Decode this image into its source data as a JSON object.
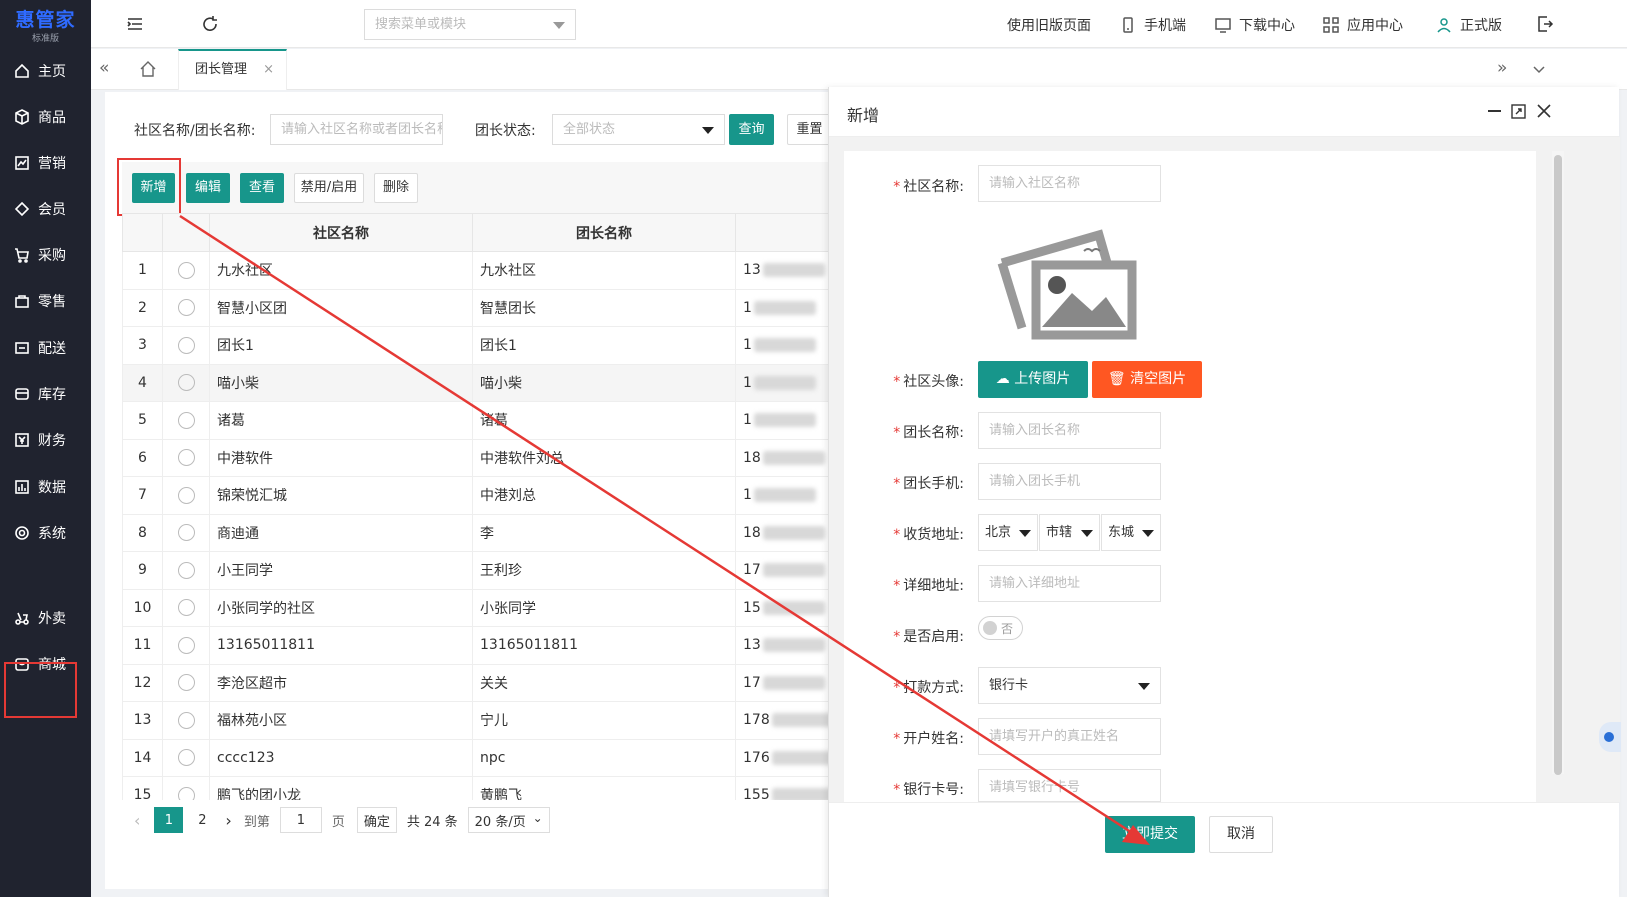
{
  "app": {
    "logo": "惠管家",
    "edition": "标准版"
  },
  "sidebar": {
    "items": [
      {
        "label": "主页",
        "icon": "home-icon"
      },
      {
        "label": "商品",
        "icon": "cube-icon"
      },
      {
        "label": "营销",
        "icon": "chart-icon"
      },
      {
        "label": "会员",
        "icon": "diamond-icon"
      },
      {
        "label": "采购",
        "icon": "cart-icon"
      },
      {
        "label": "零售",
        "icon": "bag-icon"
      },
      {
        "label": "配送",
        "icon": "truck-icon"
      },
      {
        "label": "库存",
        "icon": "box-icon"
      },
      {
        "label": "财务",
        "icon": "yen-icon"
      },
      {
        "label": "数据",
        "icon": "bar-chart-icon"
      },
      {
        "label": "系统",
        "icon": "settings-icon"
      },
      {
        "label": "外卖",
        "icon": "takeout-icon"
      },
      {
        "label": "商城",
        "icon": "mall-icon"
      }
    ]
  },
  "header": {
    "search_placeholder": "搜索菜单或模块",
    "links": [
      "使用旧版页面",
      "手机端",
      "下载中心",
      "应用中心",
      "正式版"
    ]
  },
  "tabs": {
    "active": "团长管理",
    "close": "×"
  },
  "filter": {
    "name_label": "社区名称/团长名称:",
    "name_placeholder": "请输入社区名称或者团长名称",
    "status_label": "团长状态:",
    "status_value": "全部状态",
    "query": "查询",
    "reset": "重置"
  },
  "toolbar": {
    "add": "新增",
    "edit": "编辑",
    "view": "查看",
    "toggle": "禁用/启用",
    "delete": "删除"
  },
  "table": {
    "columns": [
      "社区名称",
      "团长名称"
    ],
    "rows": [
      {
        "no": "1",
        "community": "九水社区",
        "leader": "九水社区",
        "phone": "13"
      },
      {
        "no": "2",
        "community": "智慧小区团",
        "leader": "智慧团长",
        "phone": "1"
      },
      {
        "no": "3",
        "community": "团长1",
        "leader": "团长1",
        "phone": "1"
      },
      {
        "no": "4",
        "community": "喵小柴",
        "leader": "喵小柴",
        "phone": "1"
      },
      {
        "no": "5",
        "community": "诸葛",
        "leader": "诸葛",
        "phone": "1"
      },
      {
        "no": "6",
        "community": "中港软件",
        "leader": "中港软件刘总",
        "phone": "18"
      },
      {
        "no": "7",
        "community": "锦荣悦汇城",
        "leader": "中港刘总",
        "phone": "1"
      },
      {
        "no": "8",
        "community": "商迪通",
        "leader": "李",
        "phone": "18"
      },
      {
        "no": "9",
        "community": "小王同学",
        "leader": "王利珍",
        "phone": "17"
      },
      {
        "no": "10",
        "community": "小张同学的社区",
        "leader": "小张同学",
        "phone": "15"
      },
      {
        "no": "11",
        "community": "13165011811",
        "leader": "13165011811",
        "phone": "13"
      },
      {
        "no": "12",
        "community": "李沧区超市",
        "leader": "关关",
        "phone": "17"
      },
      {
        "no": "13",
        "community": "福林苑小区",
        "leader": "宁儿",
        "phone": "178"
      },
      {
        "no": "14",
        "community": "cccc123",
        "leader": "npc",
        "phone": "176"
      },
      {
        "no": "15",
        "community": "鹏飞的团小龙",
        "leader": "黄鹏飞",
        "phone": "155"
      }
    ]
  },
  "pager": {
    "page1": "1",
    "page2": "2",
    "goto": "到第",
    "goto_value": "1",
    "page_unit": "页",
    "confirm": "确定",
    "total": "共 24 条",
    "page_size": "20 条/页"
  },
  "drawer": {
    "title": "新增",
    "fields": {
      "community_label": "社区名称:",
      "community_placeholder": "请输入社区名称",
      "avatar_label": "社区头像:",
      "upload": "上传图片",
      "clear": "清空图片",
      "leader_label": "团长名称:",
      "leader_placeholder": "请输入团长名称",
      "phone_label": "团长手机:",
      "phone_placeholder": "请输入团长手机",
      "address_label": "收货地址:",
      "province": "北京",
      "city": "市辖",
      "district": "东城",
      "detail_label": "详细地址:",
      "detail_placeholder": "请输入详细地址",
      "enabled_label": "是否启用:",
      "enabled_value": "否",
      "pay_label": "打款方式:",
      "pay_value": "银行卡",
      "account_name_label": "开户姓名:",
      "account_name_placeholder": "请填写开户的真正姓名",
      "card_label": "银行卡号:",
      "card_placeholder": "请填写银行卡号"
    },
    "submit": "立即提交",
    "cancel": "取消"
  },
  "colors": {
    "primary": "#17968b",
    "danger": "#ff5722",
    "highlight": "#e53935",
    "sidebar": "#20232f"
  }
}
